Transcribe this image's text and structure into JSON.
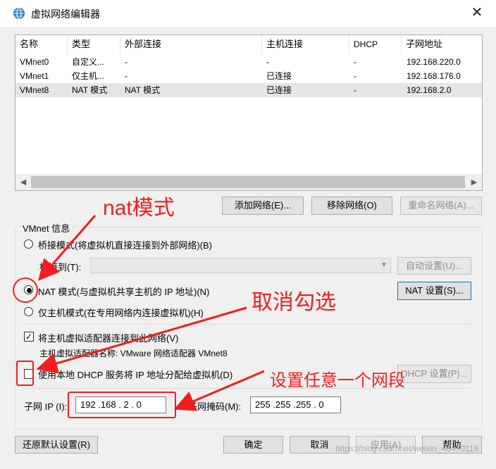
{
  "window": {
    "title": "虚拟网络编辑器",
    "close_label": "✕",
    "icon": "globe-network-icon"
  },
  "table": {
    "columns": [
      "名称",
      "类型",
      "外部连接",
      "主机连接",
      "DHCP",
      "子网地址"
    ],
    "rows": [
      {
        "name": "VMnet0",
        "type": "自定义...",
        "external": "-",
        "host": "-",
        "dhcp": "-",
        "subnet": "192.168.220.0"
      },
      {
        "name": "VMnet1",
        "type": "仅主机...",
        "external": "-",
        "host": "已连接",
        "dhcp": "-",
        "subnet": "192.168.176.0"
      },
      {
        "name": "VMnet8",
        "type": "NAT 模式",
        "external": "NAT 模式",
        "host": "已连接",
        "dhcp": "-",
        "subnet": "192.168.2.0",
        "selected": true
      }
    ]
  },
  "buttons": {
    "add_network": "添加网络(E)...",
    "remove_network": "移除网络(O)",
    "rename_network": "重命名网络(A)...",
    "auto_settings": "自动设置(U)...",
    "nat_settings": "NAT 设置(S)...",
    "dhcp_settings": "DHCP 设置(P)...",
    "restore_defaults": "还原默认设置(R)",
    "ok": "确定",
    "cancel": "取消",
    "apply": "应用(A)",
    "help": "帮助"
  },
  "vmnet_info": {
    "group_label": "VMnet 信息",
    "bridged_label": "桥接模式(将虚拟机直接连接到外部网络)(B)",
    "bridged_to_label": "桥接到(T):",
    "nat_label": "NAT 模式(与虚拟机共享主机的 IP 地址)(N)",
    "hostonly_label": "仅主机模式(在专用网络内连接虚拟机)(H)",
    "selected_mode": "nat",
    "connect_adapter_label": "将主机虚拟适配器连接到此网络(V)",
    "connect_adapter_checked": true,
    "adapter_name_text": "主机虚拟适配器名称: VMware 网络适配器 VMnet8",
    "use_dhcp_label": "使用本地 DHCP 服务将 IP 地址分配给虚拟机(D)",
    "use_dhcp_checked": false,
    "subnet_ip_label": "子网 IP (I):",
    "subnet_ip_value": "192 .168 . 2  . 0",
    "subnet_mask_label": "子网掩码(M):",
    "subnet_mask_value": "255 .255 .255 . 0"
  },
  "annotations": {
    "nat_mode": "nat模式",
    "uncheck": "取消勾选",
    "set_any_segment": "设置任意一个网段",
    "color": "#f01e1e"
  },
  "watermark": "https://blog.csdn.net/weixin_43470118"
}
